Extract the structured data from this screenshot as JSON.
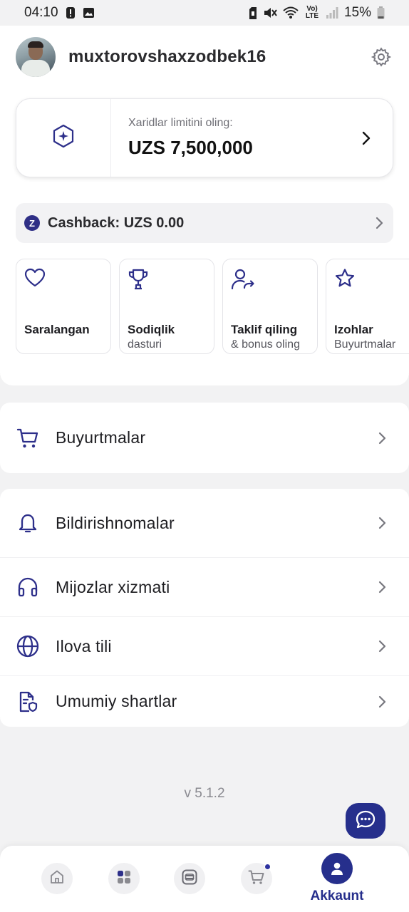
{
  "status_bar": {
    "time": "04:10",
    "battery": "15%",
    "network": "Vo) LTE"
  },
  "header": {
    "username": "muxtorovshaxzodbek16"
  },
  "limit_card": {
    "label": "Xaridlar limitini oling:",
    "amount": "UZS 7,500,000"
  },
  "cashback": {
    "badge": "Z",
    "label": "Cashback: UZS 0.00"
  },
  "tiles": [
    {
      "title": "Saralangan",
      "subtitle": ""
    },
    {
      "title": "Sodiqlik",
      "subtitle": "dasturi"
    },
    {
      "title": "Taklif qiling",
      "subtitle": "& bonus oling"
    },
    {
      "title": "Izohlar",
      "subtitle": "Buyurtmalar"
    }
  ],
  "menu": {
    "orders": "Buyurtmalar",
    "notifications": "Bildirishnomalar",
    "support": "Mijozlar xizmati",
    "language": "Ilova tili",
    "terms": "Umumiy shartlar"
  },
  "version": "v 5.1.2",
  "bottom_nav": {
    "account_label": "Akkaunt"
  },
  "colors": {
    "accent": "#262f8c",
    "icon": "#2d2f8a",
    "background": "#f2f2f3"
  }
}
